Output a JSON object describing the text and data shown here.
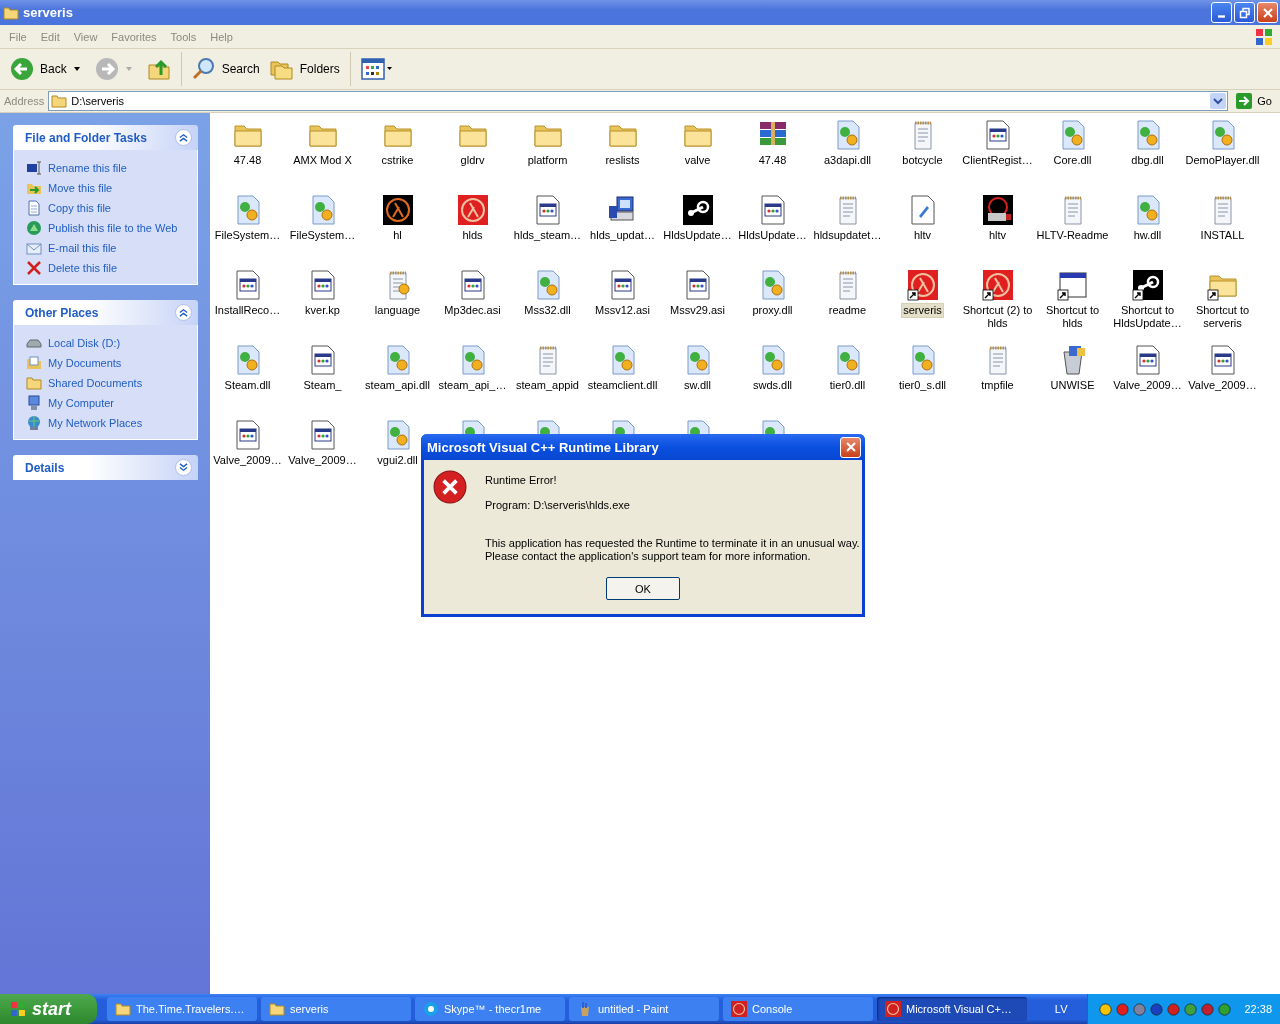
{
  "window": {
    "title": "serveris"
  },
  "menu": [
    "File",
    "Edit",
    "View",
    "Favorites",
    "Tools",
    "Help"
  ],
  "toolbar": {
    "back": "Back",
    "search": "Search",
    "folders": "Folders"
  },
  "address": {
    "label": "Address",
    "value": "D:\\serveris",
    "go": "Go"
  },
  "sidebar": [
    {
      "title": "File and Folder Tasks",
      "expanded": true,
      "items": [
        {
          "kind": "rename",
          "label": "Rename this file"
        },
        {
          "kind": "move",
          "label": "Move this file"
        },
        {
          "kind": "copy",
          "label": "Copy this file"
        },
        {
          "kind": "publish",
          "label": "Publish this file to the Web"
        },
        {
          "kind": "email",
          "label": "E-mail this file"
        },
        {
          "kind": "delete",
          "label": "Delete this file"
        }
      ]
    },
    {
      "title": "Other Places",
      "expanded": true,
      "items": [
        {
          "kind": "disk",
          "label": "Local Disk (D:)"
        },
        {
          "kind": "mydocs",
          "label": "My Documents"
        },
        {
          "kind": "shared",
          "label": "Shared Documents"
        },
        {
          "kind": "computer",
          "label": "My Computer"
        },
        {
          "kind": "network",
          "label": "My Network Places"
        }
      ]
    },
    {
      "title": "Details",
      "expanded": false
    }
  ],
  "files": [
    {
      "kind": "folder",
      "label": "47.48",
      "shortcut": false,
      "selected": false
    },
    {
      "kind": "folder",
      "label": "AMX Mod X",
      "shortcut": false,
      "selected": false
    },
    {
      "kind": "folder",
      "label": "cstrike",
      "shortcut": false,
      "selected": false
    },
    {
      "kind": "folder",
      "label": "gldrv",
      "shortcut": false,
      "selected": false
    },
    {
      "kind": "folder",
      "label": "platform",
      "shortcut": false,
      "selected": false
    },
    {
      "kind": "folder",
      "label": "reslists",
      "shortcut": false,
      "selected": false
    },
    {
      "kind": "folder",
      "label": "valve",
      "shortcut": false,
      "selected": false
    },
    {
      "kind": "archive",
      "label": "47.48",
      "shortcut": false,
      "selected": false
    },
    {
      "kind": "dll",
      "label": "a3dapi.dll",
      "shortcut": false,
      "selected": false
    },
    {
      "kind": "text",
      "label": "botcycle",
      "shortcut": false,
      "selected": false
    },
    {
      "kind": "app",
      "label": "ClientRegist…",
      "shortcut": false,
      "selected": false
    },
    {
      "kind": "dll",
      "label": "Core.dll",
      "shortcut": false,
      "selected": false
    },
    {
      "kind": "dll",
      "label": "dbg.dll",
      "shortcut": false,
      "selected": false
    },
    {
      "kind": "dll",
      "label": "DemoPlayer.dll",
      "shortcut": false,
      "selected": false
    },
    {
      "kind": "dll",
      "label": "FileSystem…",
      "shortcut": false,
      "selected": false
    },
    {
      "kind": "dll",
      "label": "FileSystem…",
      "shortcut": false,
      "selected": false
    },
    {
      "kind": "hl",
      "label": "hl",
      "shortcut": false,
      "selected": false
    },
    {
      "kind": "hlds",
      "label": "hlds",
      "shortcut": false,
      "selected": false
    },
    {
      "kind": "app",
      "label": "hlds_steam…",
      "shortcut": false,
      "selected": false
    },
    {
      "kind": "installer",
      "label": "hlds_updat…",
      "shortcut": false,
      "selected": false
    },
    {
      "kind": "steam",
      "label": "HldsUpdate…",
      "shortcut": false,
      "selected": false
    },
    {
      "kind": "app",
      "label": "HldsUpdate…",
      "shortcut": false,
      "selected": false
    },
    {
      "kind": "text",
      "label": "hldsupdatet…",
      "shortcut": false,
      "selected": false
    },
    {
      "kind": "note",
      "label": "hltv",
      "shortcut": false,
      "selected": false
    },
    {
      "kind": "hltv",
      "label": "hltv",
      "shortcut": false,
      "selected": false
    },
    {
      "kind": "text",
      "label": "HLTV-Readme",
      "shortcut": false,
      "selected": false
    },
    {
      "kind": "dll",
      "label": "hw.dll",
      "shortcut": false,
      "selected": false
    },
    {
      "kind": "text",
      "label": "INSTALL",
      "shortcut": false,
      "selected": false
    },
    {
      "kind": "app",
      "label": "InstallReco…",
      "shortcut": false,
      "selected": false
    },
    {
      "kind": "app",
      "label": "kver.kp",
      "shortcut": false,
      "selected": false
    },
    {
      "kind": "config",
      "label": "language",
      "shortcut": false,
      "selected": false
    },
    {
      "kind": "app",
      "label": "Mp3dec.asi",
      "shortcut": false,
      "selected": false
    },
    {
      "kind": "dll",
      "label": "Mss32.dll",
      "shortcut": false,
      "selected": false
    },
    {
      "kind": "app",
      "label": "Mssv12.asi",
      "shortcut": false,
      "selected": false
    },
    {
      "kind": "app",
      "label": "Mssv29.asi",
      "shortcut": false,
      "selected": false
    },
    {
      "kind": "dll",
      "label": "proxy.dll",
      "shortcut": false,
      "selected": false
    },
    {
      "kind": "text",
      "label": "readme",
      "shortcut": false,
      "selected": false
    },
    {
      "kind": "hlds",
      "label": "serveris",
      "shortcut": true,
      "selected": true
    },
    {
      "kind": "hlds",
      "label": "Shortcut (2) to hlds",
      "shortcut": true,
      "selected": false
    },
    {
      "kind": "window",
      "label": "Shortcut to hlds",
      "shortcut": true,
      "selected": false
    },
    {
      "kind": "steam",
      "label": "Shortcut to HldsUpdate…",
      "shortcut": true,
      "selected": false
    },
    {
      "kind": "folder",
      "label": "Shortcut to serveris",
      "shortcut": true,
      "selected": false
    },
    {
      "kind": "dll",
      "label": "Steam.dll",
      "shortcut": false,
      "selected": false
    },
    {
      "kind": "app",
      "label": "Steam_",
      "shortcut": false,
      "selected": false
    },
    {
      "kind": "dll",
      "label": "steam_api.dll",
      "shortcut": false,
      "selected": false
    },
    {
      "kind": "dll",
      "label": "steam_api_…",
      "shortcut": false,
      "selected": false
    },
    {
      "kind": "text",
      "label": "steam_appid",
      "shortcut": false,
      "selected": false
    },
    {
      "kind": "dll",
      "label": "steamclient.dll",
      "shortcut": false,
      "selected": false
    },
    {
      "kind": "dll",
      "label": "sw.dll",
      "shortcut": false,
      "selected": false
    },
    {
      "kind": "dll",
      "label": "swds.dll",
      "shortcut": false,
      "selected": false
    },
    {
      "kind": "dll",
      "label": "tier0.dll",
      "shortcut": false,
      "selected": false
    },
    {
      "kind": "dll",
      "label": "tier0_s.dll",
      "shortcut": false,
      "selected": false
    },
    {
      "kind": "text",
      "label": "tmpfile",
      "shortcut": false,
      "selected": false
    },
    {
      "kind": "unwise",
      "label": "UNWISE",
      "shortcut": false,
      "selected": false
    },
    {
      "kind": "app",
      "label": "Valve_2009…",
      "shortcut": false,
      "selected": false
    },
    {
      "kind": "app",
      "label": "Valve_2009…",
      "shortcut": false,
      "selected": false
    },
    {
      "kind": "app",
      "label": "Valve_2009…",
      "shortcut": false,
      "selected": false
    },
    {
      "kind": "app",
      "label": "Valve_2009…",
      "shortcut": false,
      "selected": false
    },
    {
      "kind": "dll",
      "label": "vgui2.dll",
      "shortcut": false,
      "selected": false
    },
    {
      "kind": "dll"
    },
    {
      "kind": "dll"
    },
    {
      "kind": "dll"
    },
    {
      "kind": "dll"
    },
    {
      "kind": "dll"
    }
  ],
  "dialog": {
    "title": "Microsoft Visual C++ Runtime Library",
    "heading": "Runtime Error!",
    "program": "Program: D:\\serveris\\hlds.exe",
    "message": [
      "This application has requested the Runtime to terminate it in an unusual way.",
      "Please contact the application's support team for more information."
    ],
    "button": "OK"
  },
  "taskbar": {
    "start": "start",
    "tasks": [
      {
        "kind": "folder",
        "label": "The.Time.Travelers.…",
        "selected": false
      },
      {
        "kind": "folder",
        "label": "serveris",
        "selected": false
      },
      {
        "kind": "skype",
        "label": "Skype™ - thecr1me",
        "selected": false
      },
      {
        "kind": "paint",
        "label": "untitled - Paint",
        "selected": false
      },
      {
        "kind": "hlds",
        "label": "Console",
        "selected": false
      },
      {
        "kind": "hlds",
        "label": "Microsoft Visual C+…",
        "selected": true
      }
    ],
    "language": "LV",
    "clock": "22:38"
  }
}
